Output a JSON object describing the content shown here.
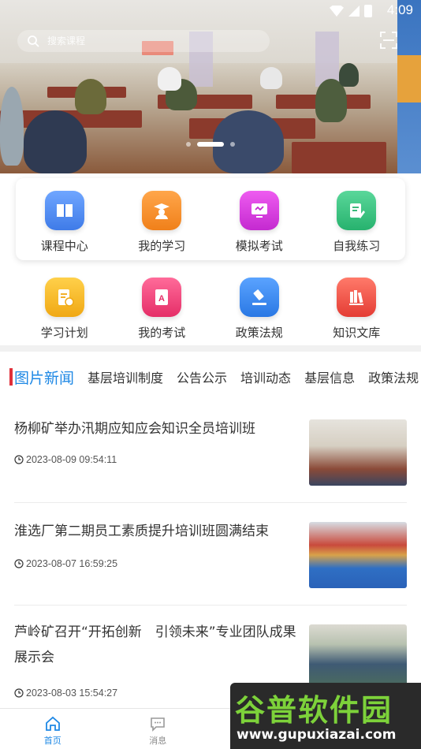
{
  "status_bar": {
    "time": "4:09"
  },
  "search": {
    "placeholder": "搜索课程"
  },
  "quick_menu": [
    {
      "label": "课程中心",
      "icon": "book-icon",
      "color": "#4d8cf5"
    },
    {
      "label": "我的学习",
      "icon": "graduate-icon",
      "color": "#f5891f"
    },
    {
      "label": "模拟考试",
      "icon": "monitor-icon",
      "color": "#d93be0"
    },
    {
      "label": "自我练习",
      "icon": "edit-note-icon",
      "color": "#33c27e"
    },
    {
      "label": "学习计划",
      "icon": "plan-document-icon",
      "color": "#f2b619"
    },
    {
      "label": "我的考试",
      "icon": "exam-paper-icon",
      "color": "#f0417a"
    },
    {
      "label": "政策法规",
      "icon": "gavel-icon",
      "color": "#3b8df2"
    },
    {
      "label": "知识文库",
      "icon": "library-books-icon",
      "color": "#f0524a"
    }
  ],
  "tabs": [
    "图片新闻",
    "基层培训制度",
    "公告公示",
    "培训动态",
    "基层信息",
    "政策法规"
  ],
  "news": [
    {
      "title": "杨柳矿举办汛期应知应会知识全员培训班",
      "time": "2023-08-09 09:54:11"
    },
    {
      "title": "淮选厂第二期员工素质提升培训班圆满结束",
      "time": "2023-08-07 16:59:25"
    },
    {
      "title": "芦岭矿召开“开拓创新　引领未来”专业团队成果展示会",
      "time": "2023-08-03 15:54:27"
    }
  ],
  "bottom_nav": [
    {
      "label": "首页",
      "icon": "home-icon"
    },
    {
      "label": "消息",
      "icon": "message-icon"
    },
    {
      "label": "",
      "icon": ""
    },
    {
      "label": "",
      "icon": ""
    }
  ],
  "watermark": {
    "text": "谷普软件园",
    "url": "www.gupuxiazai.com"
  },
  "colors": {
    "accent": "#1e88e5",
    "tab_marker": "#e0303a"
  }
}
